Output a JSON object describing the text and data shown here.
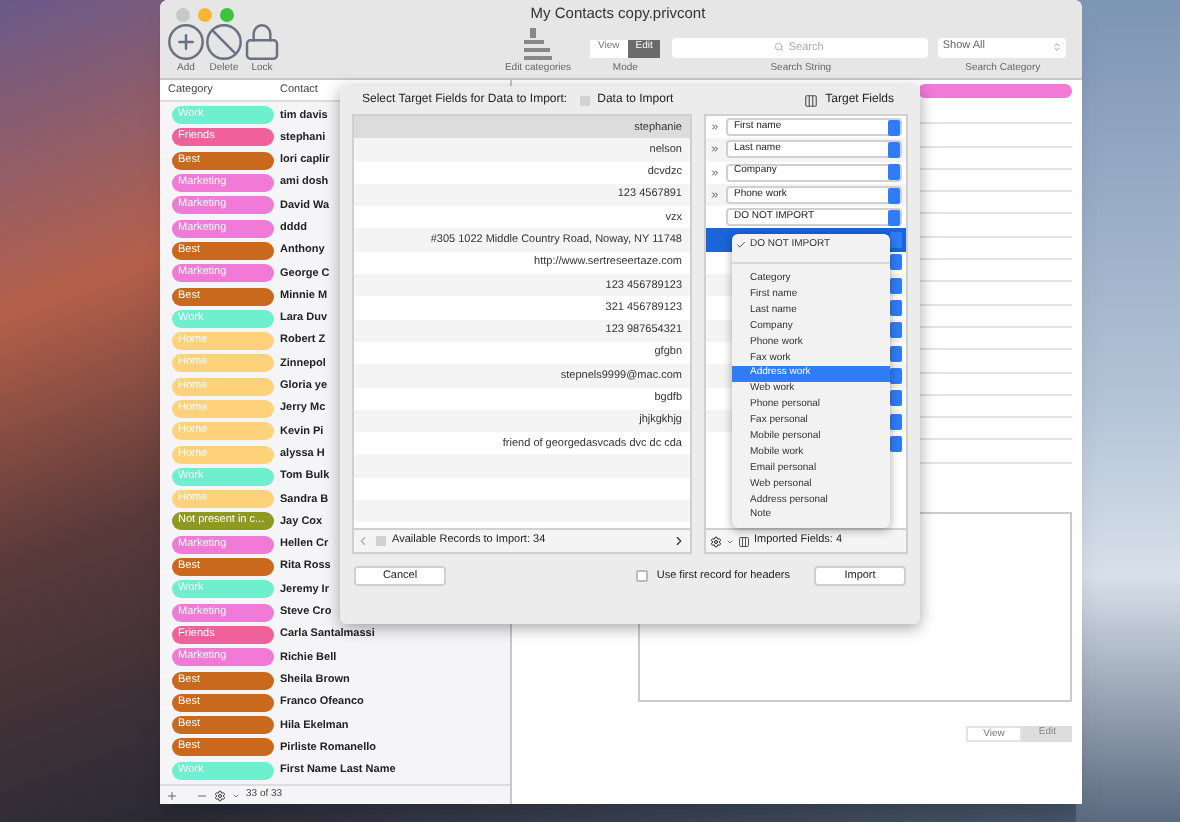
{
  "window": {
    "title": "My Contacts copy.privcont"
  },
  "toolbar": {
    "buttons": [
      {
        "kind": "add",
        "label": "Add"
      },
      {
        "kind": "delete",
        "label": "Delete"
      },
      {
        "kind": "lock",
        "label": "Lock"
      }
    ],
    "edit_categories": "Edit categories",
    "mode": {
      "label": "Mode",
      "options": [
        {
          "label": "View",
          "selected": false
        },
        {
          "label": "Edit",
          "selected": true
        }
      ]
    },
    "search": {
      "placeholder": "Search",
      "label": "Search String"
    },
    "search_category": {
      "value": "Show All",
      "label": "Search Category"
    }
  },
  "list": {
    "columns": [
      "Category",
      "Contact"
    ],
    "rows": [
      {
        "category": "Work",
        "color": "#6ef0cf",
        "contact": "tim davis"
      },
      {
        "category": "Friends",
        "color": "#f0609a",
        "contact": "stephani"
      },
      {
        "category": "Best",
        "color": "#c8691e",
        "contact": "lori caplir"
      },
      {
        "category": "Marketing",
        "color": "#f07ad6",
        "contact": "ami dosh"
      },
      {
        "category": "Marketing",
        "color": "#f07ad6",
        "contact": "David Wa"
      },
      {
        "category": "Marketing",
        "color": "#f07ad6",
        "contact": "dddd"
      },
      {
        "category": "Best",
        "color": "#c8691e",
        "contact": "Anthony"
      },
      {
        "category": "Marketing",
        "color": "#f07ad6",
        "contact": "George C"
      },
      {
        "category": "Best",
        "color": "#c8691e",
        "contact": "Minnie M"
      },
      {
        "category": "Work",
        "color": "#6ef0cf",
        "contact": "Lara Duv"
      },
      {
        "category": "Home",
        "color": "#fdd27a",
        "contact": "Robert Z"
      },
      {
        "category": "Home",
        "color": "#fdd27a",
        "contact": "Zinnepol"
      },
      {
        "category": "Home",
        "color": "#fdd27a",
        "contact": "Gloria ye"
      },
      {
        "category": "Home",
        "color": "#fdd27a",
        "contact": "Jerry Mc"
      },
      {
        "category": "Home",
        "color": "#fdd27a",
        "contact": "Kevin Pi"
      },
      {
        "category": "Home",
        "color": "#fdd27a",
        "contact": "alyssa H"
      },
      {
        "category": "Work",
        "color": "#6ef0cf",
        "contact": "Tom Bulk"
      },
      {
        "category": "Home",
        "color": "#fdd27a",
        "contact": "Sandra B"
      },
      {
        "category": "Not present in c...",
        "color": "#8c9a20",
        "contact": "Jay Cox"
      },
      {
        "category": "Marketing",
        "color": "#f07ad6",
        "contact": "Hellen Cr"
      },
      {
        "category": "Best",
        "color": "#c8691e",
        "contact": "Rita Ross"
      },
      {
        "category": "Work",
        "color": "#6ef0cf",
        "contact": "Jeremy Ir"
      },
      {
        "category": "Marketing",
        "color": "#f07ad6",
        "contact": "Steve Cro"
      },
      {
        "category": "Friends",
        "color": "#f0609a",
        "contact": "Carla Santalmassi"
      },
      {
        "category": "Marketing",
        "color": "#f07ad6",
        "contact": "Richie Bell"
      },
      {
        "category": "Best",
        "color": "#c8691e",
        "contact": "Sheila Brown"
      },
      {
        "category": "Best",
        "color": "#c8691e",
        "contact": "Franco Ofeanco"
      },
      {
        "category": "Best",
        "color": "#c8691e",
        "contact": "Hila Ekelman"
      },
      {
        "category": "Best",
        "color": "#c8691e",
        "contact": "Pirliste Romanello"
      },
      {
        "category": "Work",
        "color": "#6ef0cf",
        "contact": "First Name Last Name"
      }
    ],
    "count": "33 of 33"
  },
  "detail": {
    "mode": [
      {
        "label": "View",
        "selected": false
      },
      {
        "label": "Edit",
        "selected": true
      }
    ]
  },
  "dialog": {
    "title": "Select Target Fields for Data to Import:",
    "data_legend": "Data to Import",
    "target_legend": "Target Fields",
    "data_rows": [
      "stephanie",
      "nelson",
      "dcvdzc",
      "123 4567891",
      "vzx",
      "#305 1022 Middle Country Road, Noway, NY 11748",
      "http://www.sertreseertaze.com",
      "123 456789123",
      "321 456789123",
      "123 987654321",
      "gfgbn",
      "stepnels9999@mac.com",
      "bgdfb",
      "jhjkgkhjg",
      "friend of georgedasvcads dvc dc cda"
    ],
    "available": "Available Records to Import: 34",
    "mappings": [
      {
        "value": "First name",
        "mapped": true,
        "selected": false
      },
      {
        "value": "Last name",
        "mapped": true,
        "selected": false
      },
      {
        "value": "Company",
        "mapped": true,
        "selected": false
      },
      {
        "value": "Phone work",
        "mapped": true,
        "selected": false
      },
      {
        "value": "DO NOT IMPORT",
        "mapped": false,
        "selected": false
      },
      {
        "mapped": false,
        "selected": true
      },
      {
        "mapped": false,
        "selected": false
      },
      {
        "mapped": false,
        "selected": false
      },
      {
        "mapped": false,
        "selected": false
      },
      {
        "mapped": false,
        "selected": false
      },
      {
        "mapped": false,
        "selected": false
      },
      {
        "mapped": false,
        "selected": false
      },
      {
        "mapped": false,
        "selected": false
      },
      {
        "mapped": false,
        "selected": false
      },
      {
        "mapped": false,
        "selected": false
      }
    ],
    "imported": "Imported Fields: 4",
    "menu": [
      {
        "label": "DO NOT IMPORT",
        "checked": true,
        "selected": false
      },
      {
        "label": "Category",
        "checked": false,
        "selected": false
      },
      {
        "label": "First name",
        "checked": false,
        "selected": false
      },
      {
        "label": "Last name",
        "checked": false,
        "selected": false
      },
      {
        "label": "Company",
        "checked": false,
        "selected": false
      },
      {
        "label": "Phone work",
        "checked": false,
        "selected": false
      },
      {
        "label": "Fax work",
        "checked": false,
        "selected": false
      },
      {
        "label": "Address work",
        "checked": false,
        "selected": true
      },
      {
        "label": "Web work",
        "checked": false,
        "selected": false
      },
      {
        "label": "Phone personal",
        "checked": false,
        "selected": false
      },
      {
        "label": "Fax personal",
        "checked": false,
        "selected": false
      },
      {
        "label": "Mobile personal",
        "checked": false,
        "selected": false
      },
      {
        "label": "Mobile work",
        "checked": false,
        "selected": false
      },
      {
        "label": "Email personal",
        "checked": false,
        "selected": false
      },
      {
        "label": "Web personal",
        "checked": false,
        "selected": false
      },
      {
        "label": "Address personal",
        "checked": false,
        "selected": false
      },
      {
        "label": "Note",
        "checked": false,
        "selected": false
      }
    ],
    "cancel": "Cancel",
    "use_first_record": {
      "label": "Use first record for headers",
      "checked": false
    },
    "import": "Import"
  }
}
